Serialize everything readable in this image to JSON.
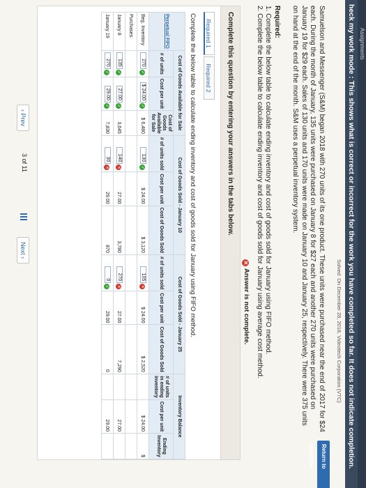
{
  "topbar": {
    "text": "Assignments"
  },
  "mode_banner": "heck my work mode : This shows what is correct or incorrect for the work you have completed so far. It does not indicate completion.",
  "solved_note": "Solved: On December 28, 2018, Videotech Corporation (VTC)",
  "return_button": "Return to question",
  "problem_text": "Samuelson and Messenger (S&M) began 2018 with 270 units of its one product. These units were purchased near the end of 2017 for $24 each. During the month of January, 135 units were purchased on January 8 for $27 each and another 270 units were purchased on January 19 for $29 each. Sales of 130 units and 170 units were made on January 10 and January 25, respectively. There were 375 units on hand at the end of the month. S&M uses a perpetual inventory system.",
  "required": {
    "heading": "Required:",
    "item1": "1. Complete the below table to calculate ending inventory and cost of goods sold for January using FIFO method.",
    "item2": "2. Complete the below table to calculate ending inventory and cost of goods sold for January using average cost method."
  },
  "status": "Answer is not complete.",
  "panel": {
    "heading": "Complete this question by entering your answers in the tabs below.",
    "tabs": [
      "Required 1",
      "Required 2"
    ],
    "instruction": "Complete the below table to calculate ending inventory and cost of goods sold for January using FIFO method."
  },
  "table": {
    "group_headers": {
      "perpetual": "Perpetual FIFO",
      "available": "Cost of Goods Available for Sale",
      "sold10": "Cost of Goods Sold - January 10",
      "sold25": "Cost of Goods Sold - January 25",
      "balance": "Inventory Balance"
    },
    "col_headers": {
      "units": "# of units",
      "cpu": "Cost per unit",
      "cogas": "Cost of Goods Available for Sale",
      "units_sold": "# of units sold",
      "cpu2": "Cost per unit",
      "cogs": "Cost of Goods Sold",
      "units_sold2": "# of units sold",
      "cpu3": "Cost per unit",
      "cogs2": "Cost of Goods Sold",
      "units_end": "# of units in ending inventory",
      "cpu4": "Cost per unit",
      "ending": "Ending Inventory"
    },
    "rows": [
      {
        "label": "Beg. Inventory",
        "units": "270",
        "cpu": "$ 24.00",
        "cogas": "$ 6,480",
        "s10_units": "130",
        "s10_cpu": "$ 24.00",
        "s10_cogs": "$ 3,120",
        "s25_units": "105",
        "s25_cpu": "$ 24.00",
        "s25_cogs": "$ 2,520",
        "end_units": "",
        "end_cpu": "$ 24.00",
        "end_val": "$"
      },
      {
        "label": "Purchases:",
        "units": "",
        "cpu": "",
        "cogas": "",
        "s10_units": "",
        "s10_cpu": "",
        "s10_cogs": "",
        "s25_units": "",
        "s25_cpu": "",
        "s25_cogs": "",
        "end_units": "",
        "end_cpu": "",
        "end_val": ""
      },
      {
        "label": "January 8",
        "units": "135",
        "cpu": "27.00",
        "cogas": "3,645",
        "s10_units": "140",
        "s10_cpu": "27.00",
        "s10_cogs": "3,780",
        "s25_units": "270",
        "s25_cpu": "27.00",
        "s25_cogs": "7,290",
        "end_units": "",
        "end_cpu": "27.00",
        "end_val": ""
      },
      {
        "label": "January 19",
        "units": "270",
        "cpu": "29.00",
        "cogas": "7,830",
        "s10_units": "30",
        "s10_cpu": "29.00",
        "s10_cogs": "870",
        "s25_units": "0",
        "s25_cpu": "29.00",
        "s25_cogs": "0",
        "end_units": "",
        "end_cpu": "29.00",
        "end_val": ""
      }
    ]
  },
  "pager": {
    "prev": "Prev",
    "page": "3",
    "of": "of 11",
    "next": "Next"
  }
}
